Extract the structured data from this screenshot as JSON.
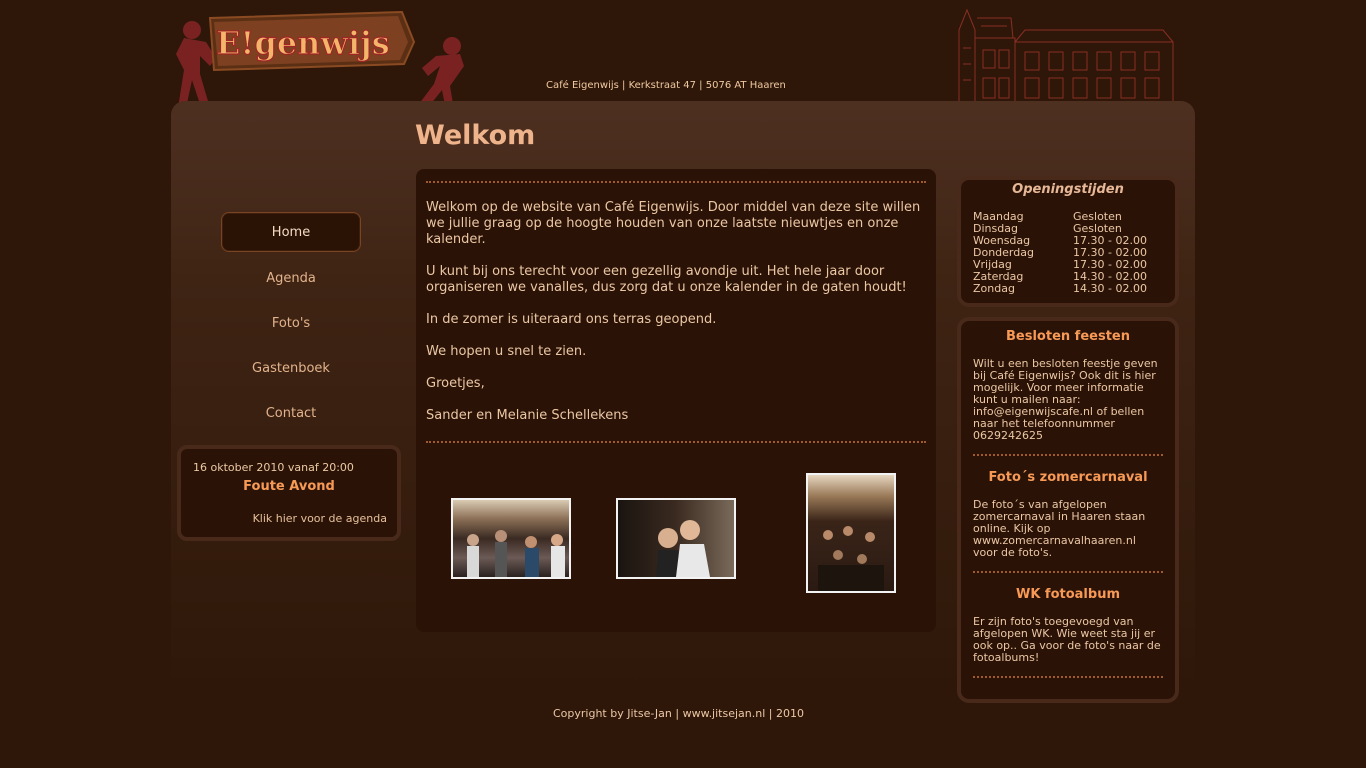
{
  "header": {
    "logo_text": "E!genwijs",
    "address": "Café Eigenwijs | Kerkstraat 47 | 5076 AT Haaren"
  },
  "main": {
    "title": "Welkom"
  },
  "nav": {
    "items": [
      {
        "label": "Home"
      },
      {
        "label": "Agenda"
      },
      {
        "label": "Foto's"
      },
      {
        "label": "Gastenboek"
      },
      {
        "label": "Contact"
      }
    ]
  },
  "event": {
    "date": "16 oktober 2010 vanaf 20:00",
    "title": "Foute Avond",
    "link": "Klik hier voor de agenda"
  },
  "content": {
    "paragraphs": [
      "Welkom op de website van Café Eigenwijs. Door middel van deze site willen we jullie graag op de hoogte houden van onze laatste nieuwtjes en onze kalender.",
      "U kunt bij ons terecht voor een gezellig avondje uit. Het hele jaar door organiseren we vanalles, dus zorg dat u onze kalender in de gaten houdt!",
      "In de zomer is uiteraard ons terras geopend.",
      "We hopen u snel te zien.",
      "Groetjes,",
      "Sander en Melanie Schellekens"
    ]
  },
  "hours": {
    "title": "Openingstijden",
    "rows": [
      {
        "day": "Maandag",
        "time": "Gesloten"
      },
      {
        "day": "Dinsdag",
        "time": "Gesloten"
      },
      {
        "day": "Woensdag",
        "time": "17.30 - 02.00"
      },
      {
        "day": "Donderdag",
        "time": "17.30 - 02.00"
      },
      {
        "day": "Vrijdag",
        "time": "17.30 - 02.00"
      },
      {
        "day": "Zaterdag",
        "time": "14.30 - 02.00"
      },
      {
        "day": "Zondag",
        "time": "14.30 - 02.00"
      }
    ]
  },
  "news": [
    {
      "title": "Besloten feesten",
      "text": "Wilt u een besloten feestje geven bij Café Eigenwijs? Ook dit is hier mogelijk. Voor meer informatie kunt u mailen naar: info@eigenwijscafe.nl of bellen naar het telefoonnummer 0629242625"
    },
    {
      "title": "Foto´s zomercarnaval",
      "text": "De foto´s van afgelopen zomercarnaval in Haaren staan online. Kijk op www.zomercarnavalhaaren.nl voor de foto's."
    },
    {
      "title": "WK fotoalbum",
      "text": "Er zijn foto's toegevoegd van afgelopen WK. Wie weet sta jij er ook op.. Ga voor de foto's naar de fotoalbums!"
    }
  ],
  "footer": {
    "text": "Copyright by Jitse-Jan | www.jitsejan.nl | 2010"
  },
  "colors": {
    "background": "#2e1709",
    "panel": "#2a1306",
    "accent": "#f89a56",
    "dots": "#a05a2c"
  }
}
